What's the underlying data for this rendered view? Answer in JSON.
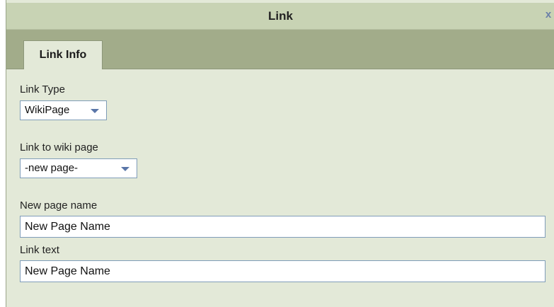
{
  "dialog": {
    "title": "Link",
    "close_glyph": "x"
  },
  "tabs": [
    {
      "label": "Link Info",
      "active": true
    }
  ],
  "form": {
    "link_type": {
      "label": "Link Type",
      "value": "WikiPage"
    },
    "link_to_wiki_page": {
      "label": "Link to wiki page",
      "value": "-new page-"
    },
    "new_page_name": {
      "label": "New page name",
      "value": "New Page Name"
    },
    "link_text": {
      "label": "Link text",
      "value": "New Page Name"
    }
  },
  "icons": {
    "close": "close-icon",
    "dropdown": "chevron-down-icon"
  },
  "colors": {
    "titlebar": "#c8d3b4",
    "tabbar": "#a2ac8a",
    "panel": "#e3e9d8",
    "input_border": "#7f9db9",
    "close_icon": "#6a7fa8"
  }
}
